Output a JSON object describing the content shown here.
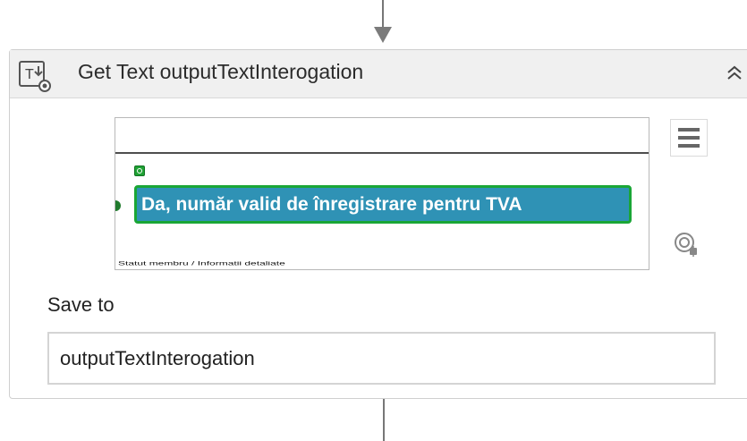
{
  "activity": {
    "title": "Get Text outputTextInterogation",
    "header_icon": "text-output-icon",
    "collapse_icon": "double-chevron-up-icon"
  },
  "preview": {
    "target_text": "Da, număr valid de înregistrare pentru TVA",
    "marker_icon": "target-marker-icon",
    "menu_icon": "hamburger-menu-icon",
    "settings_icon": "target-settings-icon"
  },
  "save_to": {
    "label": "Save to",
    "value": "outputTextInterogation"
  },
  "colors": {
    "target_fill": "#2f92b5",
    "target_border": "#1aa636",
    "header_bg": "#f0f0f0"
  }
}
